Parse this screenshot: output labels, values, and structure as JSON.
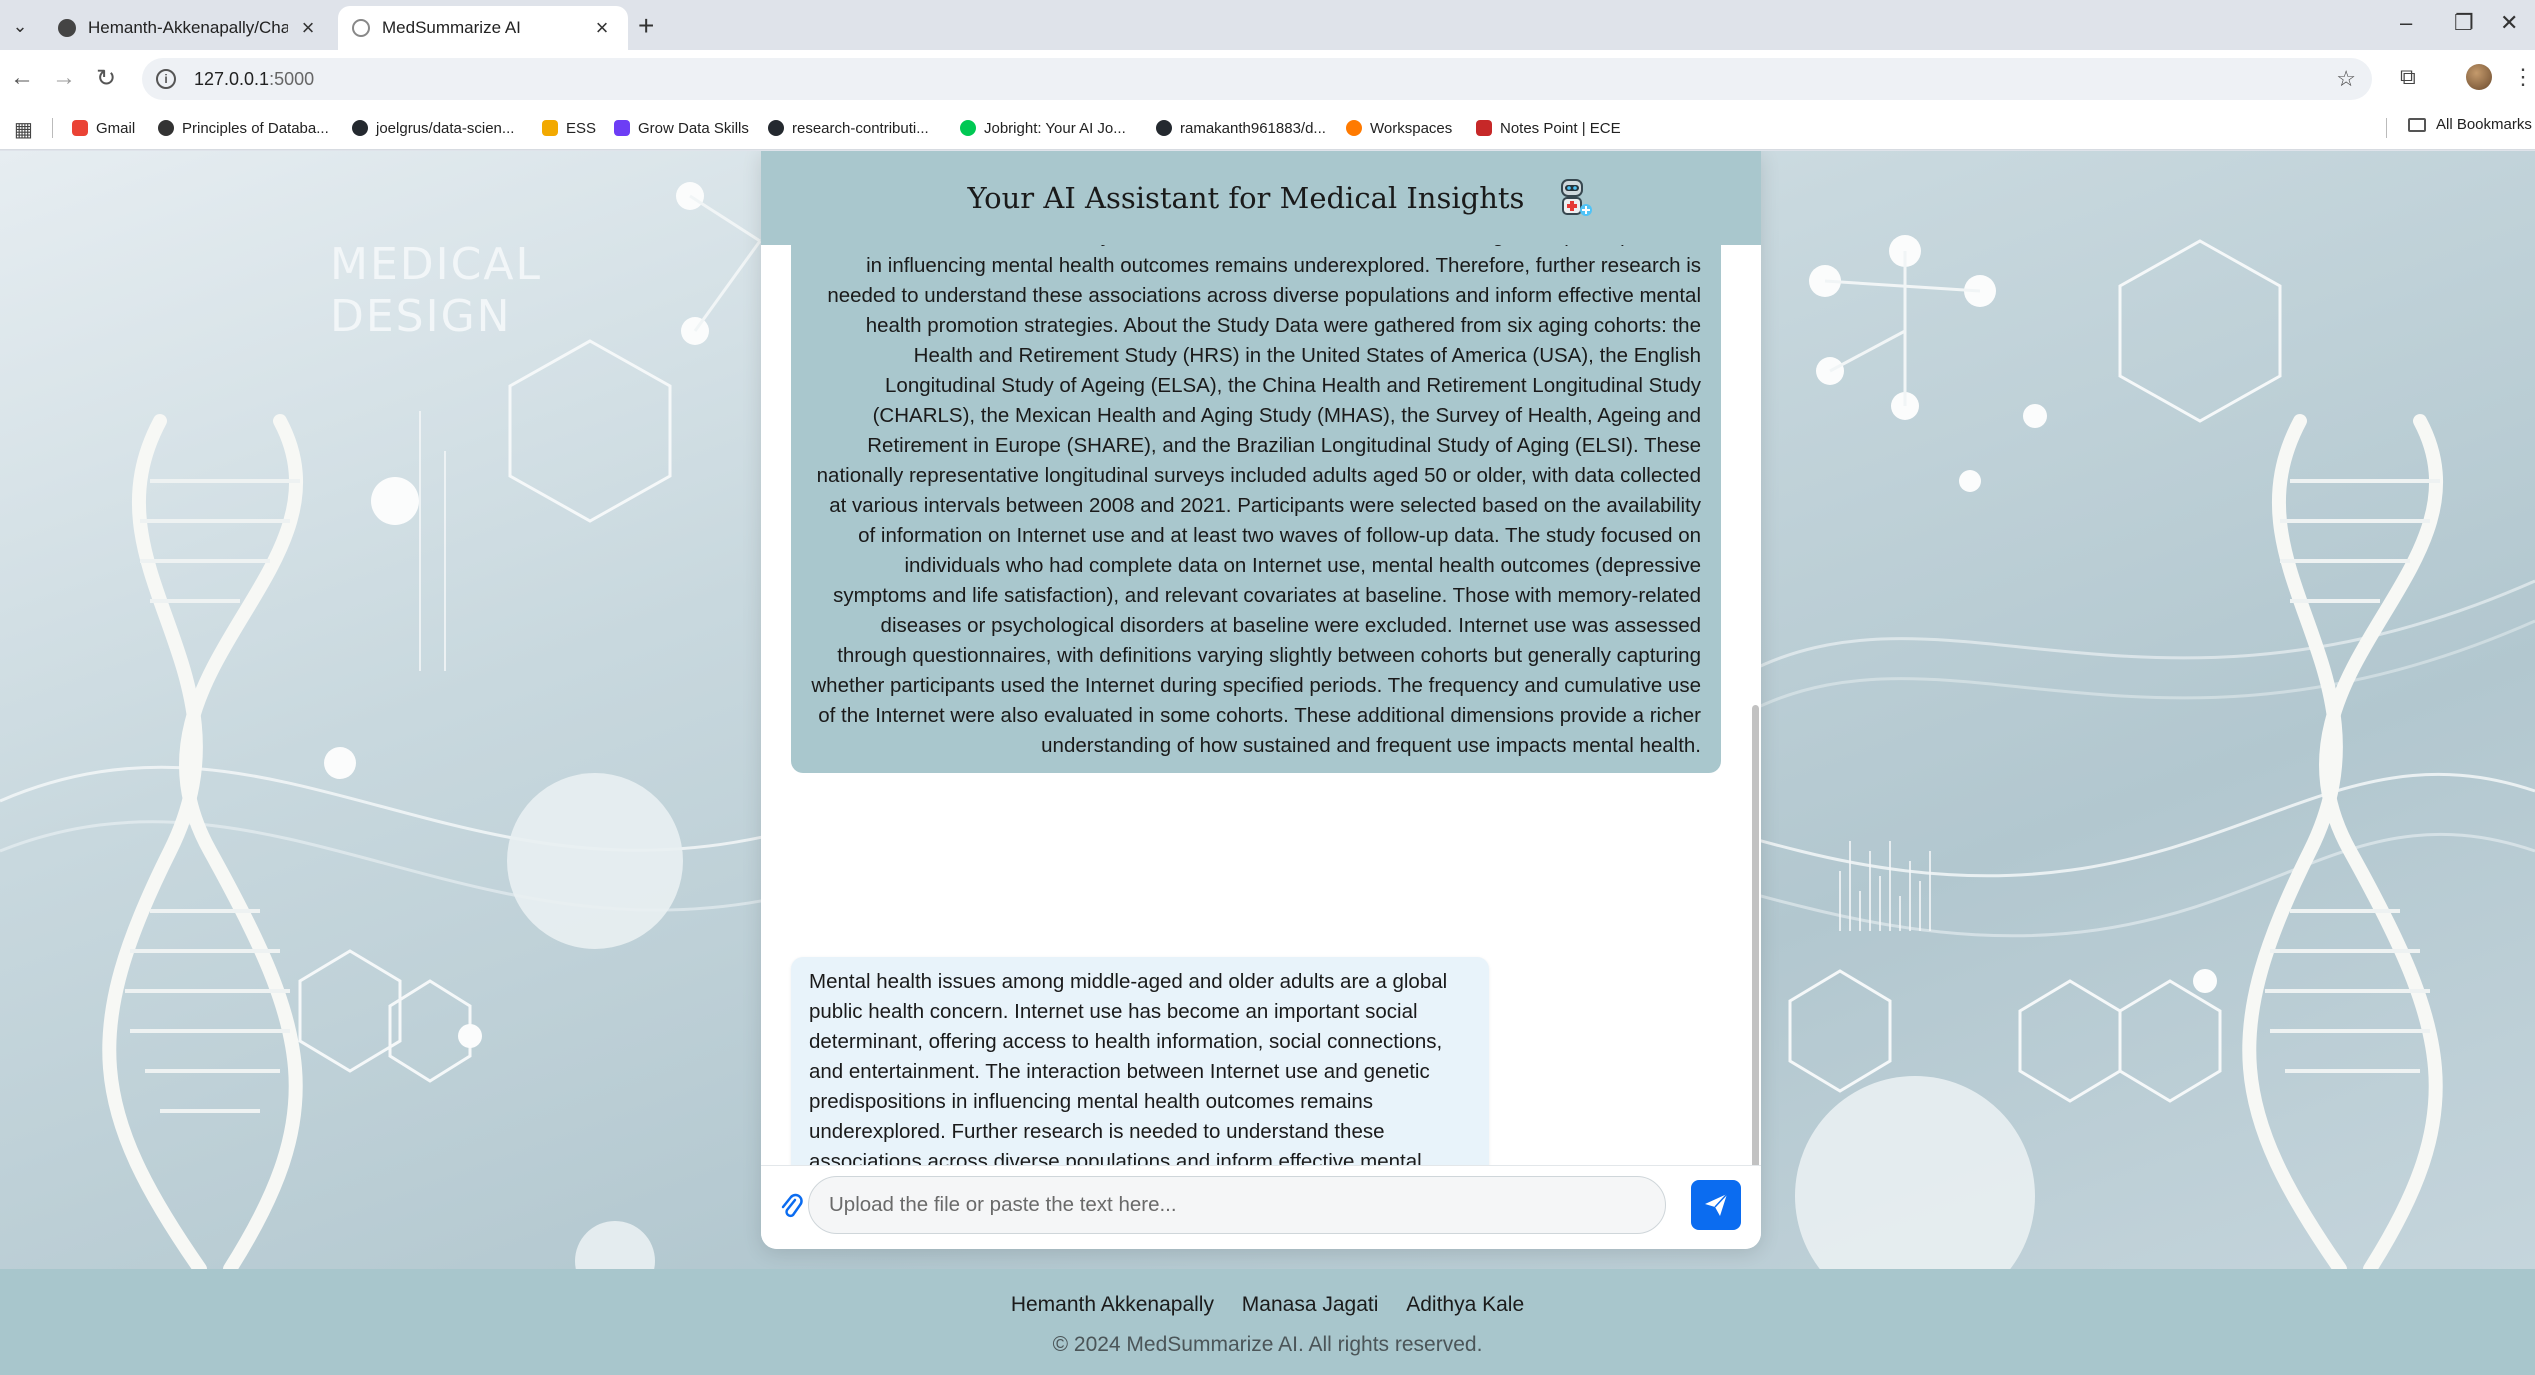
{
  "browser": {
    "tabs": [
      {
        "title": "Hemanth-Akkenapally/Chatbot",
        "active": false
      },
      {
        "title": "MedSummarize AI",
        "active": true
      }
    ],
    "url_host": "127.0.0.1",
    "url_port": ":5000",
    "bookmarks": [
      {
        "label": "Gmail",
        "color": "#ea4335"
      },
      {
        "label": "Principles of Databa...",
        "color": "#333333"
      },
      {
        "label": "joelgrus/data-scien...",
        "color": "#24292f"
      },
      {
        "label": "ESS",
        "color": "#f2a900"
      },
      {
        "label": "Grow Data Skills",
        "color": "#6d3df5"
      },
      {
        "label": "research-contributi...",
        "color": "#24292f"
      },
      {
        "label": "Jobright: Your AI Jo...",
        "color": "#00c853"
      },
      {
        "label": "ramakanth961883/d...",
        "color": "#24292f"
      },
      {
        "label": "Workspaces",
        "color": "#ff7a00"
      },
      {
        "label": "Notes Point | ECE",
        "color": "#c62828"
      }
    ],
    "all_bookmarks_label": "All Bookmarks"
  },
  "background": {
    "title_line1": "MEDICAL",
    "title_line2": "DESIGN"
  },
  "chat": {
    "header_title": "Your AI Assistant for Medical Insights",
    "user_message": "research findings are mixed, and most studies focus on single countries, overlooking cross-national differences. Additionally, the interaction between Internet use and genetic predispositions in influencing mental health outcomes remains underexplored. Therefore, further research is needed to understand these associations across diverse populations and inform effective mental health promotion strategies. About the Study Data were gathered from six aging cohorts: the Health and Retirement Study (HRS) in the United States of America (USA), the English Longitudinal Study of Ageing (ELSA), the China Health and Retirement Longitudinal Study (CHARLS), the Mexican Health and Aging Study (MHAS), the Survey of Health, Ageing and Retirement in Europe (SHARE), and the Brazilian Longitudinal Study of Aging (ELSI). These nationally representative longitudinal surveys included adults aged 50 or older, with data collected at various intervals between 2008 and 2021. Participants were selected based on the availability of information on Internet use and at least two waves of follow-up data. The study focused on individuals who had complete data on Internet use, mental health outcomes (depressive symptoms and life satisfaction), and relevant covariates at baseline. Those with memory-related diseases or psychological disorders at baseline were excluded. Internet use was assessed through questionnaires, with definitions varying slightly between cohorts but generally capturing whether participants used the Internet during specified periods. The frequency and cumulative use of the Internet were also evaluated in some cohorts. These additional dimensions provide a richer understanding of how sustained and frequent use impacts mental health.",
    "bot_message": "Mental health issues among middle-aged and older adults are a global public health concern. Internet use has become an important social determinant, offering access to health information, social connections, and entertainment. The interaction between Internet use and genetic predispositions in influencing mental health outcomes remains underexplored. Further research is needed to understand these associations across diverse populations and inform effective mental health promotion strategies.",
    "input_placeholder": "Upload the file or paste the text here...",
    "input_value": ""
  },
  "footer": {
    "authors": [
      "Hemanth Akkenapally",
      "Manasa Jagati",
      "Adithya Kale"
    ],
    "copyright": "© 2024 MedSummarize AI. All rights reserved."
  },
  "colors": {
    "header_bg": "#a9c7cd",
    "bot_bubble": "#e8f3fa",
    "send_button": "#0b6cf0",
    "footer_bg": "#a8c6cc"
  }
}
